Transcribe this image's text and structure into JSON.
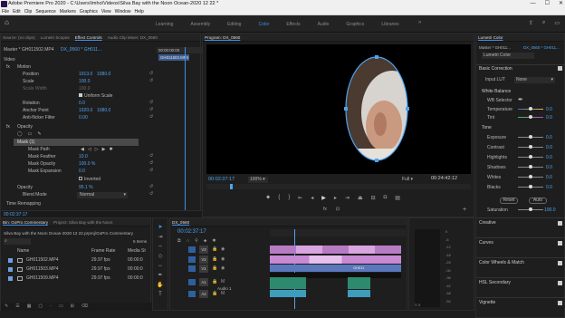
{
  "window": {
    "title": "Adobe Premiere Pro 2020 - C:\\Users\\Imho\\Videos\\Silva Bay with the Noon Ocean-2020 12 22 *",
    "minimize": "—",
    "maximize": "☐",
    "close": "✕"
  },
  "menu": [
    "File",
    "Edit",
    "Clip",
    "Sequence",
    "Markers",
    "Graphics",
    "View",
    "Window",
    "Help"
  ],
  "workspaces": {
    "home_icon": "home-icon",
    "tabs": [
      "Learning",
      "Assembly",
      "Editing",
      "Color",
      "Effects",
      "Audio",
      "Graphics",
      "Libraries"
    ],
    "active": "Color",
    "more": "»",
    "right_icons": [
      "share-icon",
      "search-icon",
      "chat-icon"
    ]
  },
  "effect_controls": {
    "tabs": [
      "Source: (no clips)",
      "Lumetri Scopes",
      "Effect Controls",
      "Audio Clip Mixer: DX_0560"
    ],
    "master": "Master * GH011502.MP4",
    "clip": "DX_0560 * GH011...",
    "timeruler": "00:00:00:00",
    "clip_label": "GH011502.MP4",
    "section_video": "Video",
    "motion": "Motion",
    "position": {
      "label": "Position",
      "x": "1913.0",
      "y": "1080.0"
    },
    "scale": {
      "label": "Scale",
      "value": "100.0"
    },
    "scale_width": {
      "label": "Scale Width",
      "value": "100.0"
    },
    "uniform_scale": "Uniform Scale",
    "rotation": {
      "label": "Rotation",
      "value": "0.0"
    },
    "anchor": {
      "label": "Anchor Point",
      "x": "1920.0",
      "y": "1080.0"
    },
    "anti_flicker": {
      "label": "Anti-flicker Filter",
      "value": "0.00"
    },
    "opacity": "Opacity",
    "mask": "Mask (1)",
    "mask_path": "Mask Path",
    "mask_feather": {
      "label": "Mask Feather",
      "value": "10.0"
    },
    "mask_opacity": {
      "label": "Mask Opacity",
      "value": "100.0 %"
    },
    "mask_expansion": {
      "label": "Mask Expansion",
      "value": "0.0"
    },
    "inverted": "Inverted",
    "opacity_val": {
      "label": "Opacity",
      "value": "95.1 %"
    },
    "blend": {
      "label": "Blend Mode",
      "value": "Normal"
    },
    "time_remap": "Time Remapping",
    "timecode": "00:02:37:17"
  },
  "program": {
    "title": "Program: DX_0560",
    "timecode": "00:02:37:17",
    "zoom": "100%",
    "quality": "Full",
    "duration": "00:24:42:12"
  },
  "lumetri": {
    "tab": "Lumetri Color",
    "master": "Master * GH011...",
    "clip": "DX_0560 * GH011...",
    "effect": "Lumetri Color",
    "basic": "Basic Correction",
    "input_lut": {
      "label": "Input LUT",
      "value": "None"
    },
    "wb": "White Balance",
    "wb_selector": "WB Selector",
    "temperature": {
      "label": "Temperature",
      "value": "0.0"
    },
    "tint": {
      "label": "Tint",
      "value": "0.0"
    },
    "tone": "Tone",
    "tone_rows": [
      {
        "label": "Exposure",
        "value": "0.0"
      },
      {
        "label": "Contrast",
        "value": "0.0"
      },
      {
        "label": "Highlights",
        "value": "0.0"
      },
      {
        "label": "Shadows",
        "value": "0.0"
      },
      {
        "label": "Whites",
        "value": "0.0"
      },
      {
        "label": "Blacks",
        "value": "0.0"
      }
    ],
    "reset": "Reset",
    "auto": "Auto",
    "saturation": {
      "label": "Saturation",
      "value": "100.0"
    },
    "sections": [
      "Creative",
      "Curves",
      "Color Wheels & Match",
      "HSL Secondary",
      "Vignette"
    ]
  },
  "project": {
    "tabs": [
      "Bin: GoPro Commentary",
      "Project: Silva Bay with the Noon"
    ],
    "path": "Silva Bay with the Noon Ocean-2020 12 22.prproj\\GoPro Commentary",
    "items_count": "5 Items",
    "columns": [
      "Name",
      "Frame Rate",
      "Media St"
    ],
    "rows": [
      {
        "name": "GH011502.MP4",
        "rate": "29.97 fps",
        "start": "00:00:0"
      },
      {
        "name": "GH011503.MP4",
        "rate": "29.97 fps",
        "start": "00:00:0"
      },
      {
        "name": "GH011509.MP4",
        "rate": "29.97 fps",
        "start": "00:00:0"
      }
    ]
  },
  "timeline": {
    "tab": "DX_0560",
    "timecode": "00:02:37:17",
    "tracks": [
      "V3",
      "V2",
      "V1",
      "A1",
      "A2"
    ],
    "audio_label": "Audio 1",
    "clip_label": "GH011"
  },
  "meter": {
    "ticks": [
      "0",
      "-6",
      "-12",
      "-18",
      "-24",
      "-30",
      "-36",
      "-42",
      "-48",
      "-54"
    ]
  }
}
